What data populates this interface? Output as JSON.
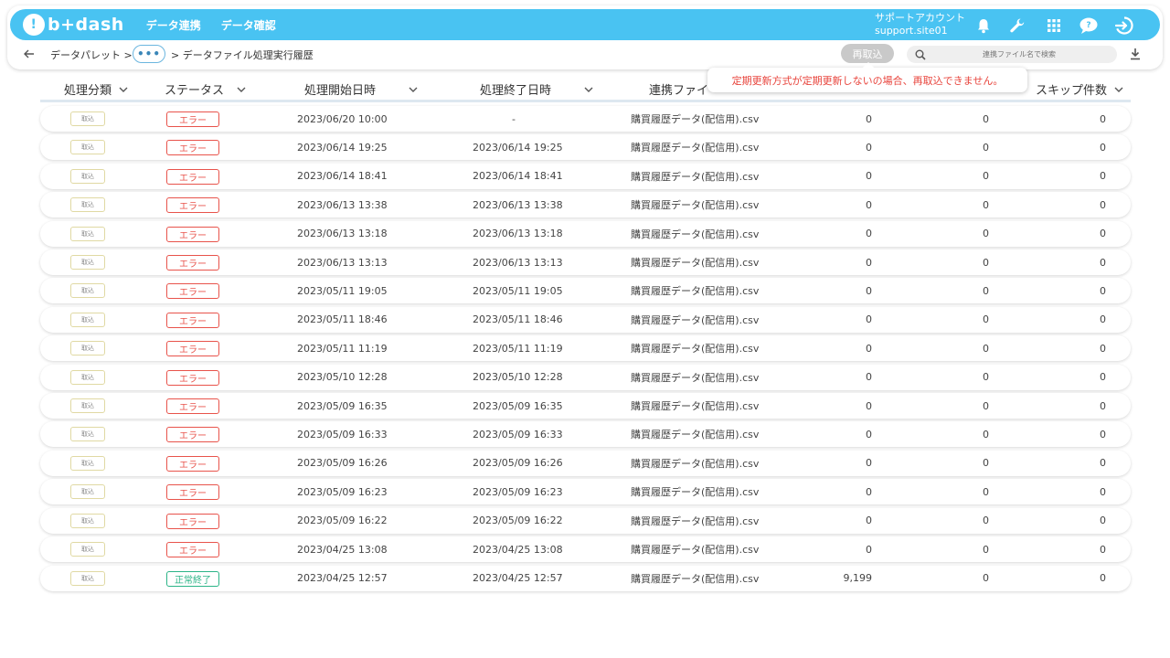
{
  "header": {
    "logo_text": "b+dash",
    "nav": [
      "データ連携",
      "データ確認"
    ],
    "account_line1": "サポートアカウント",
    "account_line2": "support.site01"
  },
  "breadcrumb": {
    "item1": "データパレット >",
    "ellipsis": "•••",
    "item2": "> データファイル処理実行履歴"
  },
  "toolbar": {
    "reload_label": "再取込",
    "search_placeholder": "連携ファイル名で検索"
  },
  "tooltip": "定期更新方式が定期更新しないの場合、再取込できません。",
  "columns": {
    "type": "処理分類",
    "status": "ステータス",
    "start": "処理開始日時",
    "end": "処理終了日時",
    "file": "連携ファイ",
    "skip": "スキップ件数"
  },
  "colors": {
    "primary": "#49c3f2",
    "error": "#e8534b",
    "success": "#2bb487"
  },
  "rows": [
    {
      "type": "取込",
      "status": "エラー",
      "start": "2023/06/20 10:00",
      "end": "-",
      "file": "購買履歴データ(配信用).csv",
      "n1": "0",
      "n2": "0",
      "n3": "0"
    },
    {
      "type": "取込",
      "status": "エラー",
      "start": "2023/06/14 19:25",
      "end": "2023/06/14 19:25",
      "file": "購買履歴データ(配信用).csv",
      "n1": "0",
      "n2": "0",
      "n3": "0"
    },
    {
      "type": "取込",
      "status": "エラー",
      "start": "2023/06/14 18:41",
      "end": "2023/06/14 18:41",
      "file": "購買履歴データ(配信用).csv",
      "n1": "0",
      "n2": "0",
      "n3": "0"
    },
    {
      "type": "取込",
      "status": "エラー",
      "start": "2023/06/13 13:38",
      "end": "2023/06/13 13:38",
      "file": "購買履歴データ(配信用).csv",
      "n1": "0",
      "n2": "0",
      "n3": "0"
    },
    {
      "type": "取込",
      "status": "エラー",
      "start": "2023/06/13 13:18",
      "end": "2023/06/13 13:18",
      "file": "購買履歴データ(配信用).csv",
      "n1": "0",
      "n2": "0",
      "n3": "0"
    },
    {
      "type": "取込",
      "status": "エラー",
      "start": "2023/06/13 13:13",
      "end": "2023/06/13 13:13",
      "file": "購買履歴データ(配信用).csv",
      "n1": "0",
      "n2": "0",
      "n3": "0"
    },
    {
      "type": "取込",
      "status": "エラー",
      "start": "2023/05/11 19:05",
      "end": "2023/05/11 19:05",
      "file": "購買履歴データ(配信用).csv",
      "n1": "0",
      "n2": "0",
      "n3": "0"
    },
    {
      "type": "取込",
      "status": "エラー",
      "start": "2023/05/11 18:46",
      "end": "2023/05/11 18:46",
      "file": "購買履歴データ(配信用).csv",
      "n1": "0",
      "n2": "0",
      "n3": "0"
    },
    {
      "type": "取込",
      "status": "エラー",
      "start": "2023/05/11 11:19",
      "end": "2023/05/11 11:19",
      "file": "購買履歴データ(配信用).csv",
      "n1": "0",
      "n2": "0",
      "n3": "0"
    },
    {
      "type": "取込",
      "status": "エラー",
      "start": "2023/05/10 12:28",
      "end": "2023/05/10 12:28",
      "file": "購買履歴データ(配信用).csv",
      "n1": "0",
      "n2": "0",
      "n3": "0"
    },
    {
      "type": "取込",
      "status": "エラー",
      "start": "2023/05/09 16:35",
      "end": "2023/05/09 16:35",
      "file": "購買履歴データ(配信用).csv",
      "n1": "0",
      "n2": "0",
      "n3": "0"
    },
    {
      "type": "取込",
      "status": "エラー",
      "start": "2023/05/09 16:33",
      "end": "2023/05/09 16:33",
      "file": "購買履歴データ(配信用).csv",
      "n1": "0",
      "n2": "0",
      "n3": "0"
    },
    {
      "type": "取込",
      "status": "エラー",
      "start": "2023/05/09 16:26",
      "end": "2023/05/09 16:26",
      "file": "購買履歴データ(配信用).csv",
      "n1": "0",
      "n2": "0",
      "n3": "0"
    },
    {
      "type": "取込",
      "status": "エラー",
      "start": "2023/05/09 16:23",
      "end": "2023/05/09 16:23",
      "file": "購買履歴データ(配信用).csv",
      "n1": "0",
      "n2": "0",
      "n3": "0"
    },
    {
      "type": "取込",
      "status": "エラー",
      "start": "2023/05/09 16:22",
      "end": "2023/05/09 16:22",
      "file": "購買履歴データ(配信用).csv",
      "n1": "0",
      "n2": "0",
      "n3": "0"
    },
    {
      "type": "取込",
      "status": "エラー",
      "start": "2023/04/25 13:08",
      "end": "2023/04/25 13:08",
      "file": "購買履歴データ(配信用).csv",
      "n1": "0",
      "n2": "0",
      "n3": "0"
    },
    {
      "type": "取込",
      "status": "正常終了",
      "start": "2023/04/25 12:57",
      "end": "2023/04/25 12:57",
      "file": "購買履歴データ(配信用).csv",
      "n1": "9,199",
      "n2": "0",
      "n3": "0"
    }
  ]
}
